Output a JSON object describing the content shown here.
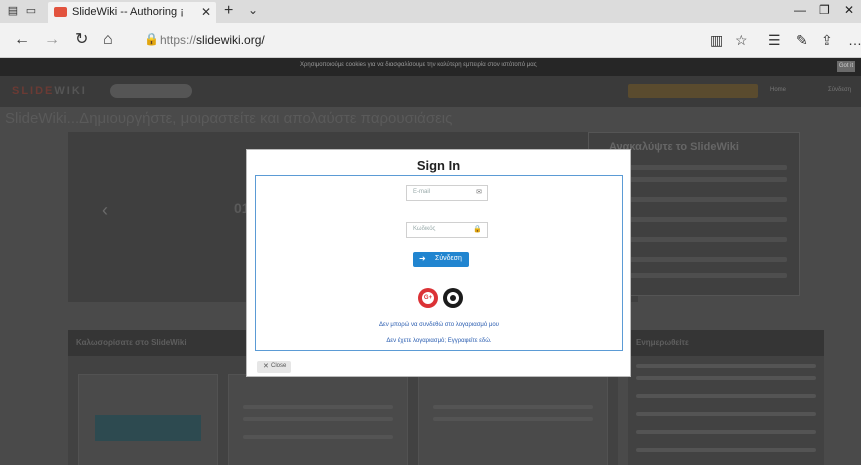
{
  "browser": {
    "tab_title": "SlideWiki -- Authoring ¡",
    "url_protocol": "https://",
    "url_host": "slidewiki.org/"
  },
  "page": {
    "cookie_notice": "Χρησιμοποιούμε cookies για να διασφαλίσουμε την καλύτερη εμπειρία στον ιστότοπό μας",
    "cookie_button": "Got it",
    "logo_left": "SLIDE",
    "logo_right": "WIKI",
    "nav_link_1": "Home",
    "nav_link_2": "Σύνδεση",
    "heading": "SlideWiki...Δημιουργήστε, μοιραστείτε και απολαύστε παρουσιάσεις",
    "hero_fragment": "01",
    "discover_title": "Ανακαλύψτε το SlideWiki",
    "lower_left_header": "Καλωσορίσατε στο SlideWiki",
    "lower_right_header": "Ενημερωθείτε"
  },
  "modal": {
    "title": "Sign In",
    "email_placeholder": "E-mail",
    "password_placeholder": "Κωδικός",
    "login_label": "Σύνδεση",
    "google_label": "G+",
    "forgot_link": "Δεν μπορώ να συνδεθώ στο λογαριασμό μου",
    "signup_link": "Δεν έχετε λογαριασμό; Εγγραφείτε εδώ.",
    "close_label": "Close"
  },
  "icons": {
    "email": "✉",
    "lock": "🔒",
    "login": "➜"
  }
}
